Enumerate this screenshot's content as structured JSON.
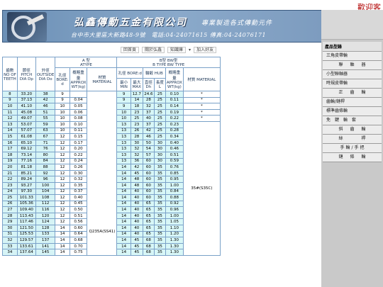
{
  "welcome_text": "歡迎客",
  "banner": {
    "company": "弘鑫傳動五金有限公司",
    "slogan": "專業製造各式傳動元件",
    "address": "台中市大里區大新路48-9號　電話:04-24071615 傳真:04-24076171"
  },
  "nav": {
    "links": [
      "回首頁",
      "關於弘鑫",
      "知識庫",
      "加入好友"
    ],
    "arrow": "▾"
  },
  "sidebar": {
    "title": "產品型錄",
    "items": [
      "三角皮帶輪",
      "聯　軸　器",
      "小型聯軸器",
      "時規皮帶輪",
      "正　齒　輪",
      "齒輪/鏈桿",
      "標準齒條輪",
      "免　鍵　輪　套",
      "斜　齒　輪",
      "絲　　　桿",
      "手輪/手把",
      "鏈　條　輪"
    ]
  },
  "table": {
    "headers": {
      "no": "齒數 NO OF TEETH",
      "pitch": "節徑 PITCH DIA Dp",
      "outside": "外徑 OUTSIDE DIA Do",
      "a_type_top": "A 型",
      "a_type": "ATYPE",
      "bore": "孔徑 BORE: d",
      "approx": "概略重量 APPROX WT(kg)",
      "material": "材質 MATERIAL",
      "b_type_top": "B型 BW型",
      "b_type": "B TYPE  BW TYPE",
      "bore_b": "孔徑 BORE:d",
      "hub": "輪轂 HUB",
      "min": "最小 MIN",
      "max": "最大 MAX",
      "dh": "直徑 Dh",
      "l": "長度 L",
      "approx_b": "概略重量 APPROX WT(kg)",
      "material_b": "材質 MATERIAL"
    },
    "material_a": "Q235A(SS41)",
    "material_b": "35#(S35C)",
    "stars": [
      "*",
      "*",
      "*",
      "*",
      "*"
    ],
    "rows": [
      [
        "8",
        "33.20",
        "38",
        "9",
        "",
        "9",
        "12.7",
        "24.6",
        "25",
        "0.10"
      ],
      [
        "9",
        "37.13",
        "42",
        "9",
        "0.04",
        "9",
        "14",
        "28",
        "25",
        "0.11"
      ],
      [
        "10",
        "41.10",
        "46",
        "10",
        "0.05",
        "9",
        "18",
        "32",
        "25",
        "0.14"
      ],
      [
        "11",
        "45.08",
        "51",
        "10",
        "0.06",
        "10",
        "23",
        "37",
        "25",
        "0.19"
      ],
      [
        "12",
        "49.07",
        "55",
        "10",
        "0.08",
        "10",
        "25",
        "40",
        "25",
        "0.22"
      ],
      [
        "13",
        "53.07",
        "59",
        "10",
        "0.10",
        "13",
        "23",
        "37",
        "25",
        "0.23"
      ],
      [
        "14",
        "57.07",
        "63",
        "10",
        "0.11",
        "13",
        "26",
        "42",
        "25",
        "0.28"
      ],
      [
        "15",
        "61.08",
        "67",
        "12",
        "0.15",
        "13",
        "28",
        "46",
        "25",
        "0.34"
      ],
      [
        "16",
        "65.10",
        "71",
        "12",
        "0.17",
        "13",
        "30",
        "50",
        "30",
        "0.40"
      ],
      [
        "17",
        "69.12",
        "76",
        "12",
        "0.20",
        "13",
        "32",
        "54",
        "30",
        "0.46"
      ],
      [
        "18",
        "73.14",
        "80",
        "12",
        "0.22",
        "13",
        "32",
        "57",
        "30",
        "0.51"
      ],
      [
        "19",
        "77.16",
        "84",
        "12",
        "0.24",
        "13",
        "36",
        "60",
        "30",
        "0.59"
      ],
      [
        "20",
        "81.18",
        "88",
        "12",
        "0.26",
        "14",
        "42",
        "60",
        "35",
        "0.76"
      ],
      [
        "21",
        "85.21",
        "92",
        "12",
        "0.30",
        "14",
        "45",
        "60",
        "35",
        "0.85"
      ],
      [
        "22",
        "89.24",
        "96",
        "12",
        "0.32",
        "14",
        "48",
        "60",
        "35",
        "0.95"
      ],
      [
        "23",
        "93.27",
        "100",
        "12",
        "0.35",
        "14",
        "48",
        "60",
        "35",
        "1.00"
      ],
      [
        "24",
        "97.30",
        "104",
        "12",
        "0.37",
        "14",
        "40",
        "60",
        "35",
        "0.84"
      ],
      [
        "25",
        "101.33",
        "108",
        "12",
        "0.40",
        "14",
        "40",
        "60",
        "35",
        "0.88"
      ],
      [
        "26",
        "105.36",
        "112",
        "12",
        "0.45",
        "14",
        "40",
        "65",
        "35",
        "0.92"
      ],
      [
        "27",
        "109.40",
        "116",
        "12",
        "0.50",
        "14",
        "40",
        "65",
        "35",
        "0.96"
      ],
      [
        "28",
        "113.43",
        "120",
        "12",
        "0.51",
        "14",
        "40",
        "65",
        "35",
        "1.00"
      ],
      [
        "29",
        "117.46",
        "124",
        "12",
        "0.56",
        "14",
        "40",
        "65",
        "35",
        "1.05"
      ],
      [
        "30",
        "121.50",
        "128",
        "14",
        "0.60",
        "14",
        "40",
        "65",
        "35",
        "1.10"
      ],
      [
        "31",
        "125.53",
        "133",
        "14",
        "0.64",
        "14",
        "40",
        "65",
        "35",
        "1.20"
      ],
      [
        "32",
        "129.57",
        "137",
        "14",
        "0.68",
        "14",
        "45",
        "68",
        "35",
        "1.30"
      ],
      [
        "33",
        "133.61",
        "141",
        "14",
        "0.70",
        "14",
        "45",
        "68",
        "35",
        "1.30"
      ],
      [
        "34",
        "137.64",
        "145",
        "14",
        "0.75",
        "14",
        "45",
        "68",
        "35",
        "1.30"
      ]
    ]
  }
}
